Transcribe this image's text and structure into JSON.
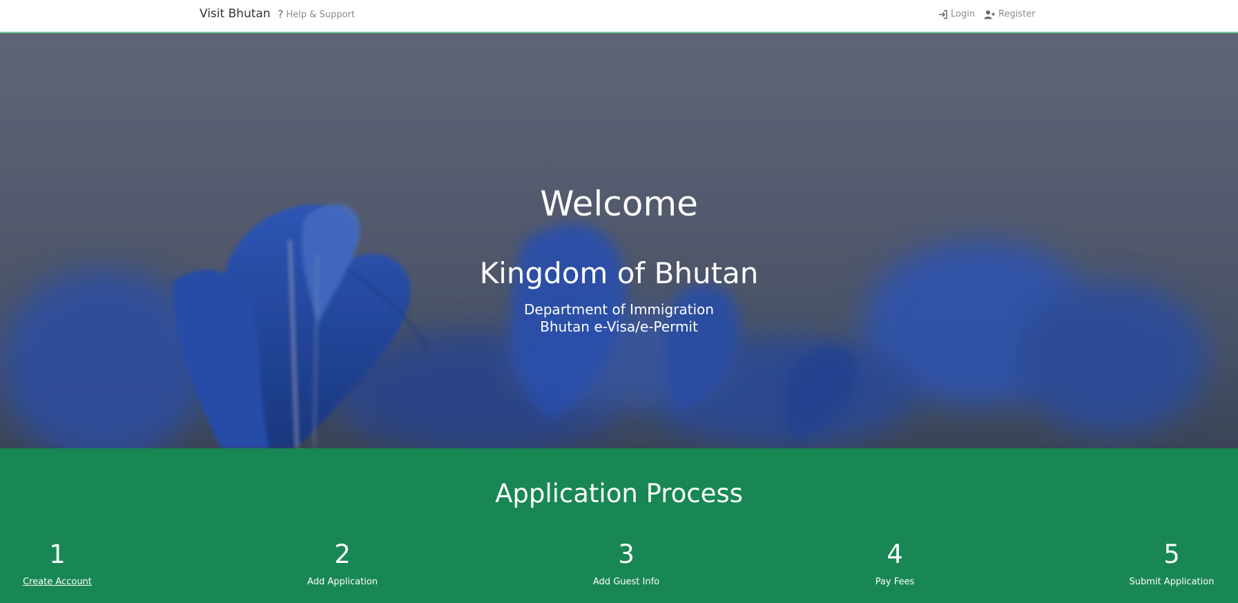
{
  "navbar": {
    "brand": "Visit Bhutan",
    "help_label": "Help & Support",
    "login_label": "Login",
    "register_label": "Register",
    "icons": {
      "help": "question-icon",
      "login": "sign-in-icon",
      "register": "user-plus-icon"
    },
    "accent_color": "#6fcf97"
  },
  "hero": {
    "welcome": "Welcome",
    "kingdom": "Kingdom of Bhutan",
    "department": "Department of Immigration",
    "visa": "Bhutan e-Visa/e-Permit"
  },
  "process": {
    "title": "Application Process",
    "background_color": "#198754",
    "steps": [
      {
        "number": "1",
        "label": "Create Account"
      },
      {
        "number": "2",
        "label": "Add Application"
      },
      {
        "number": "3",
        "label": "Add Guest Info"
      },
      {
        "number": "4",
        "label": "Pay Fees"
      },
      {
        "number": "5",
        "label": "Submit Application"
      }
    ]
  }
}
